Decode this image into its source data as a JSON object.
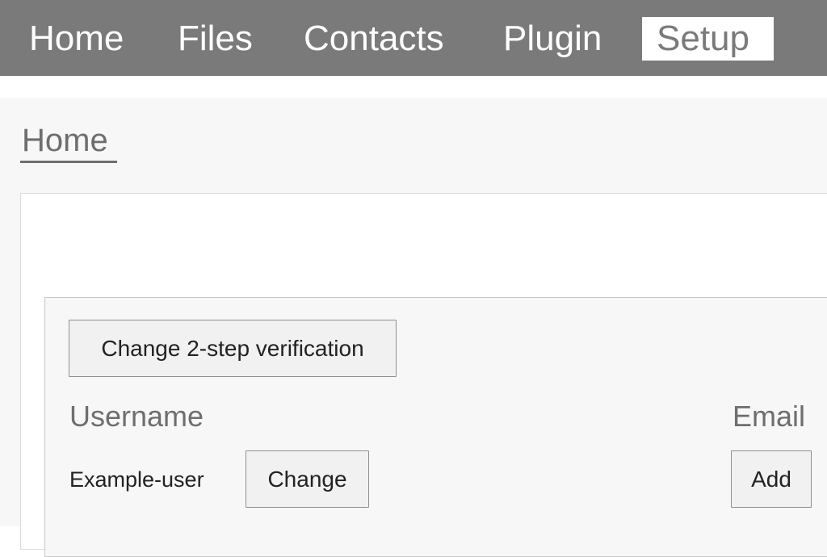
{
  "nav": {
    "items": [
      {
        "label": "Home"
      },
      {
        "label": "Files"
      },
      {
        "label": "Contacts"
      },
      {
        "label": "Plugin"
      },
      {
        "label": "Setup",
        "active": true
      }
    ]
  },
  "page": {
    "title": "Home"
  },
  "account": {
    "two_step_button": "Change 2-step verification",
    "username_label": "Username",
    "username_value": "Example-user",
    "username_change_button": "Change",
    "email_label": "Email",
    "email_add_button": "Add"
  },
  "colors": {
    "nav_background": "#7a7a7a",
    "nav_text": "#ffffff",
    "active_tab_background": "#ffffff",
    "active_tab_text": "#7a7a7a",
    "content_background": "#f7f7f7"
  }
}
